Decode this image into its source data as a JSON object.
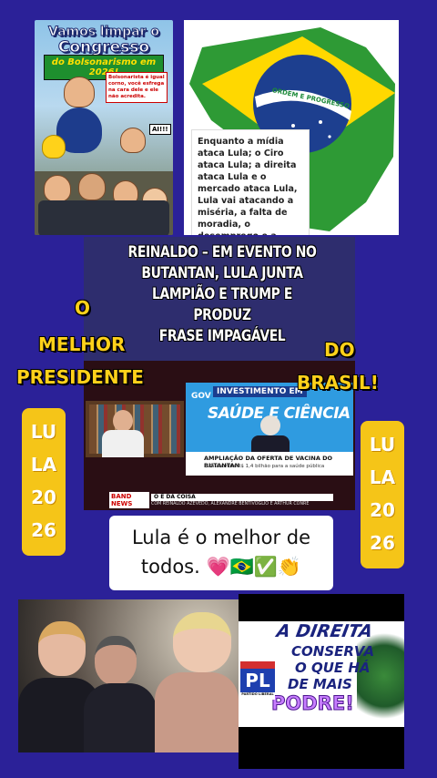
{
  "poster": {
    "title_line1": "Vamos limpar o",
    "title_line2": "Congresso",
    "banner": "do Bolsonarismo em 2026!",
    "bubble": "Bolsonarista é igual corno, você esfrega na cara dele e ele não acredita.",
    "exclaim": "AI!!!"
  },
  "flag_image": {
    "motto": "ORDEM E PROGRESSO",
    "card_text": "Enquanto a mídia ataca Lula; o Ciro ataca Lula; a direita ataca Lula e o mercado ataca Lula, Lula vai atacando a miséria, a falta de moradia, o desemprego e a inflação."
  },
  "headline": {
    "lines": [
      "REINALDO – EM EVENTO NO",
      "BUTANTAN, LULA JUNTA",
      "LAMPIÃO E TRUMP E PRODUZ",
      "FRASE IMPAGÁVEL"
    ]
  },
  "slogan": {
    "o": "O",
    "melhor": "MELHOR",
    "presidente": "PRESIDENTE",
    "do": "DO",
    "brasil": "BRASIL!"
  },
  "badge_left": [
    "LU",
    "LA",
    "20",
    "26"
  ],
  "badge_right": [
    "LU",
    "LA",
    "20",
    "26"
  ],
  "tv": {
    "banner_top": "INVESTIMENTO EM",
    "banner_main": "SAÚDE E CIÊNCIA",
    "lower_third_title": "AMPLIAÇÃO DA OFERTA DE VACINA DO BUTANTAN",
    "lower_third_sub": "Lula anuncia R$ 1,4 bilhão para a saúde pública",
    "channel": "BAND NEWS",
    "show": "O É DA COISA",
    "hosts": "COM REINALDO AZEVEDO, ALEXANDRE BENTIVOGLIO E ARTHUR CONRE",
    "gov_logo": "GOV"
  },
  "praise": {
    "line1": "Lula é o melhor de",
    "line2": "todos. 💗🇧🇷✅👏"
  },
  "pl_image": {
    "line1": "A DIREITA",
    "line2": "CONSERVA",
    "line3": "O QUE HÁ",
    "line4": "DE MAIS",
    "line5": "PODRE!",
    "logo": "PL",
    "party": "PARTIDO LIBERAL"
  },
  "colors": {
    "background": "#2b2198",
    "yellow": "#ffd11a",
    "badge": "#f5c518"
  }
}
